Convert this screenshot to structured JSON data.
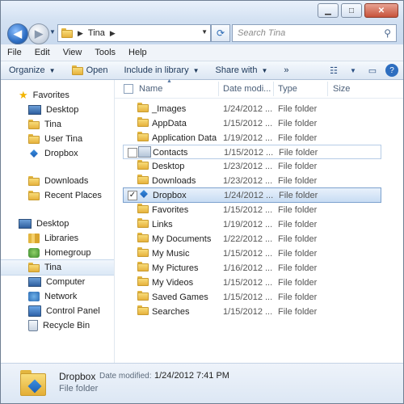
{
  "window": {
    "breadcrumb": [
      "Tina"
    ],
    "search_placeholder": "Search Tina"
  },
  "menubar": [
    "File",
    "Edit",
    "View",
    "Tools",
    "Help"
  ],
  "toolbar": {
    "organize": "Organize",
    "open": "Open",
    "include": "Include in library",
    "share": "Share with"
  },
  "navpane": {
    "favorites_header": "Favorites",
    "favorites": [
      "Desktop",
      "Tina",
      "User Tina",
      "Dropbox"
    ],
    "group2": [
      "Downloads",
      "Recent Places"
    ],
    "desktop_header": "Desktop",
    "desktop_items": [
      "Libraries",
      "Homegroup",
      "Tina",
      "Computer",
      "Network",
      "Control Panel",
      "Recycle Bin"
    ]
  },
  "columns": {
    "name": "Name",
    "date": "Date modi...",
    "type": "Type",
    "size": "Size"
  },
  "files": [
    {
      "name": "_Images",
      "date": "1/24/2012 ...",
      "type": "File folder"
    },
    {
      "name": "AppData",
      "date": "1/15/2012 ...",
      "type": "File folder"
    },
    {
      "name": "Application Data",
      "date": "1/19/2012 ...",
      "type": "File folder"
    },
    {
      "name": "Contacts",
      "date": "1/15/2012 ...",
      "type": "File folder"
    },
    {
      "name": "Desktop",
      "date": "1/23/2012 ...",
      "type": "File folder"
    },
    {
      "name": "Downloads",
      "date": "1/23/2012 ...",
      "type": "File folder"
    },
    {
      "name": "Dropbox",
      "date": "1/24/2012 ...",
      "type": "File folder"
    },
    {
      "name": "Favorites",
      "date": "1/15/2012 ...",
      "type": "File folder"
    },
    {
      "name": "Links",
      "date": "1/19/2012 ...",
      "type": "File folder"
    },
    {
      "name": "My Documents",
      "date": "1/22/2012 ...",
      "type": "File folder"
    },
    {
      "name": "My Music",
      "date": "1/15/2012 ...",
      "type": "File folder"
    },
    {
      "name": "My Pictures",
      "date": "1/16/2012 ...",
      "type": "File folder"
    },
    {
      "name": "My Videos",
      "date": "1/15/2012 ...",
      "type": "File folder"
    },
    {
      "name": "Saved Games",
      "date": "1/15/2012 ...",
      "type": "File folder"
    },
    {
      "name": "Searches",
      "date": "1/15/2012 ...",
      "type": "File folder"
    }
  ],
  "details": {
    "name": "Dropbox",
    "date_label": "Date modified:",
    "date_value": "1/24/2012 7:41 PM",
    "type": "File folder"
  }
}
